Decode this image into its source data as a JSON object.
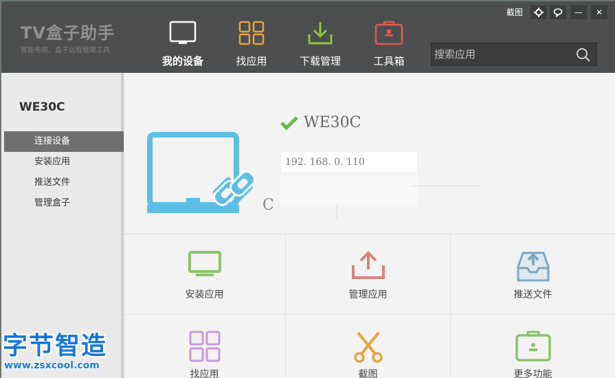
{
  "header": {
    "logo_title": "TV盒子助手",
    "logo_subtitle": "智能电视，盒子远程管理工具",
    "screenshot_label": "截图",
    "settings_icon": "gear-icon",
    "feedback_icon": "chat-icon",
    "minimize_label": "—",
    "close_label": "✕",
    "search_placeholder": "搜索应用",
    "nav": [
      {
        "label": "我的设备",
        "icon": "monitor-icon",
        "active": true
      },
      {
        "label": "找应用",
        "icon": "grid-icon",
        "active": false
      },
      {
        "label": "下载管理",
        "icon": "download-icon",
        "active": false
      },
      {
        "label": "工具箱",
        "icon": "toolbox-icon",
        "active": false
      }
    ]
  },
  "sidebar": {
    "device_name": "WE30C",
    "items": [
      {
        "label": "连接设备",
        "active": true
      },
      {
        "label": "安装应用",
        "active": false
      },
      {
        "label": "推送文件",
        "active": false
      },
      {
        "label": "管理盒子",
        "active": false
      }
    ]
  },
  "device": {
    "name": "WE30C",
    "ip": "192. 168. 0. 110",
    "partial_text": "C"
  },
  "tiles": [
    {
      "label": "安装应用",
      "icon": "tv-install-icon",
      "color": "#8cc36a"
    },
    {
      "label": "管理应用",
      "icon": "upload-icon",
      "color": "#d7837d"
    },
    {
      "label": "推送文件",
      "icon": "inbox-push-icon",
      "color": "#7ba7c4"
    },
    {
      "label": "找应用",
      "icon": "grid-icon",
      "color": "#c79ad8"
    },
    {
      "label": "截图",
      "icon": "scissors-icon",
      "color": "#e6a43e"
    },
    {
      "label": "更多功能",
      "icon": "toolbox-icon",
      "color": "#8cc36a"
    }
  ],
  "watermark": {
    "big": "字节智造",
    "small": "www.zsxcool.com"
  }
}
